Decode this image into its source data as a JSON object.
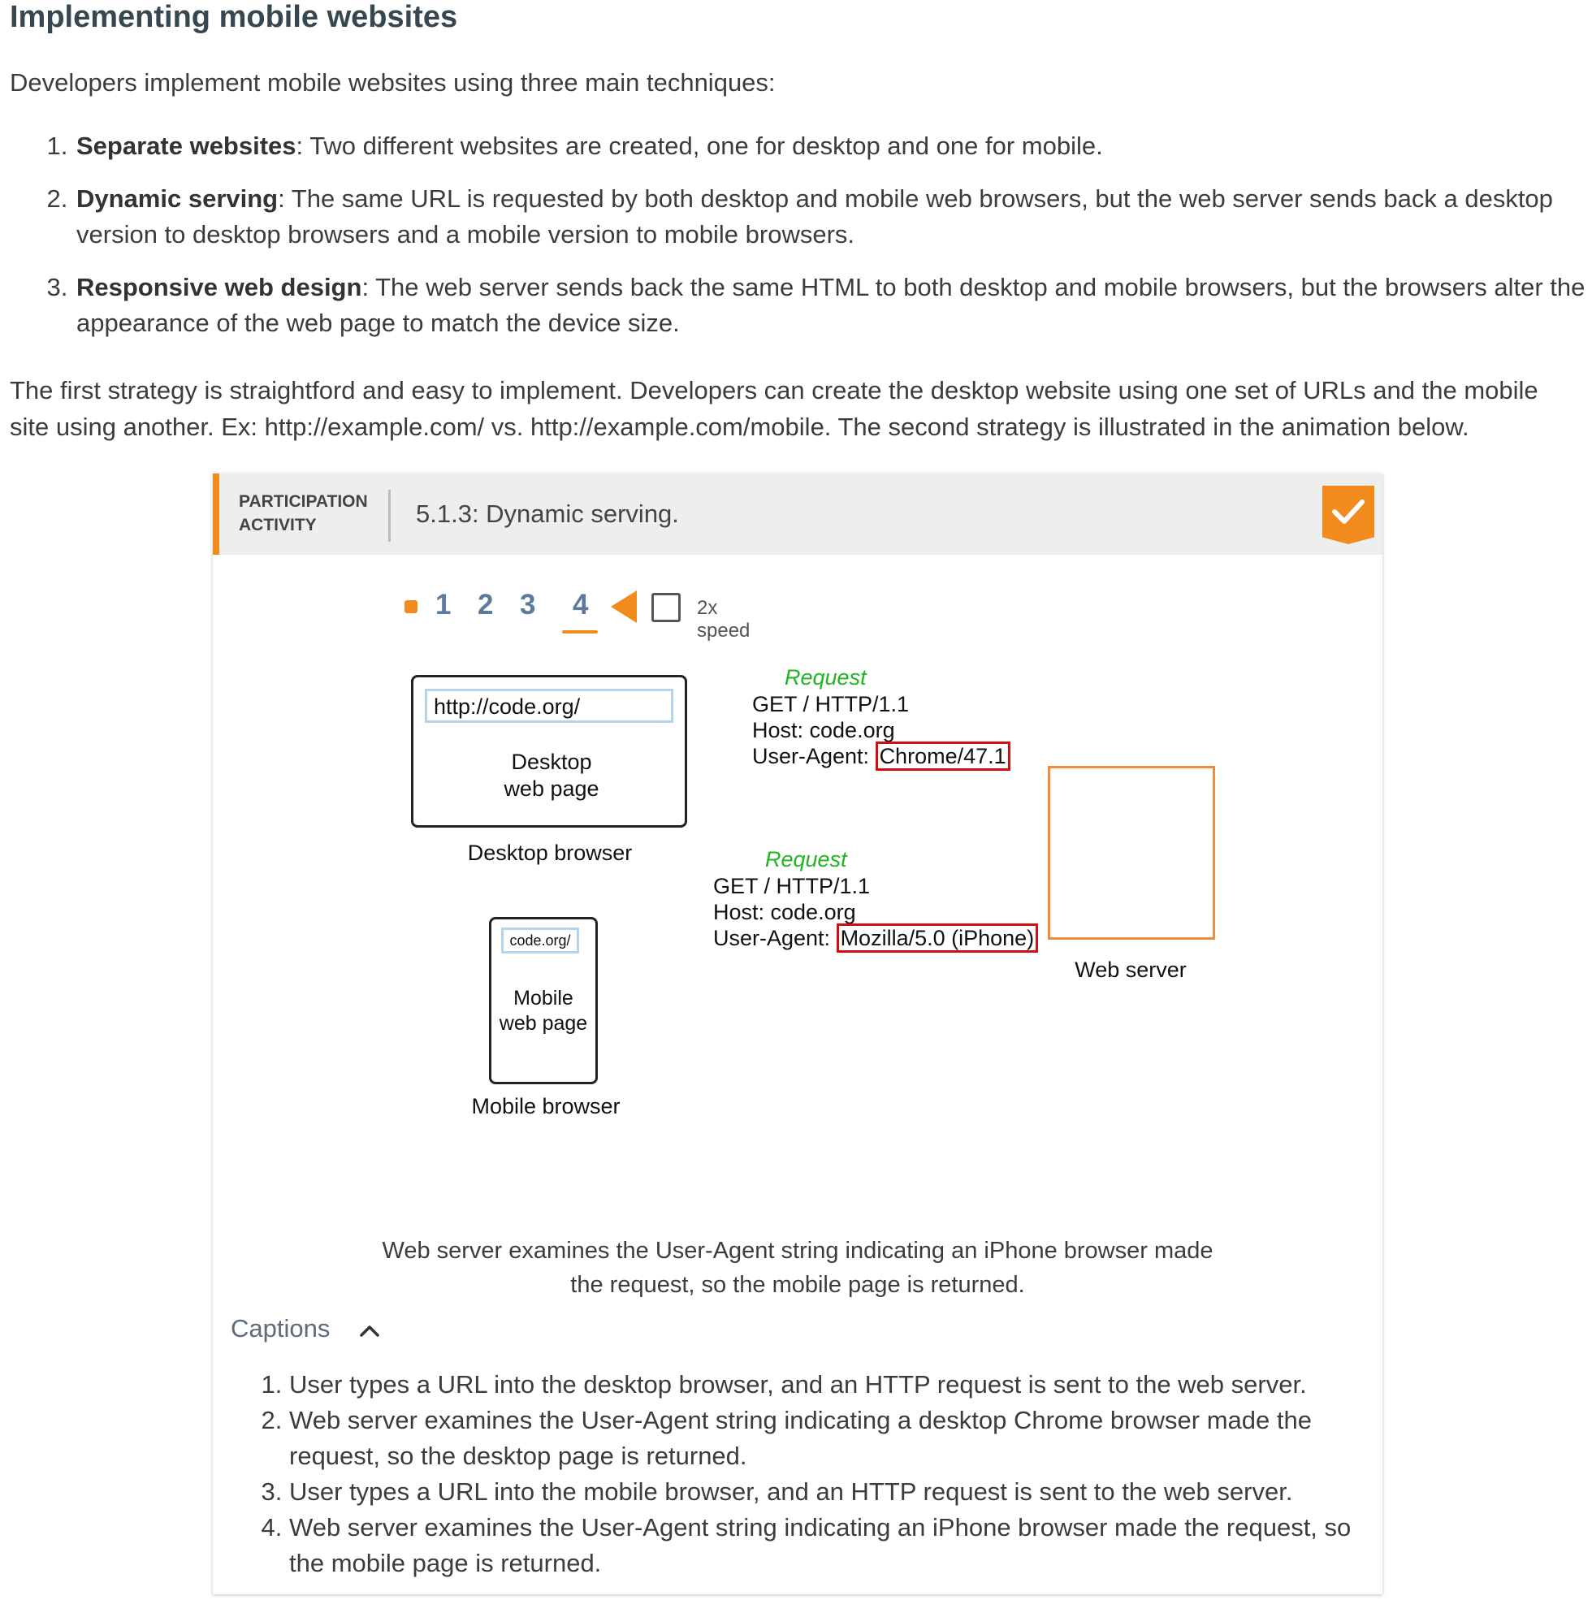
{
  "page": {
    "title": "Implementing mobile websites",
    "intro": "Developers implement mobile websites using three main techniques:",
    "techniques": [
      {
        "term": "Separate websites",
        "text": ": Two different websites are created, one for desktop and one for mobile."
      },
      {
        "term": "Dynamic serving",
        "text": ": The same URL is requested by both desktop and mobile web browsers, but the web server sends back a desktop version to desktop browsers and a mobile version to mobile browsers."
      },
      {
        "term": "Responsive web design",
        "text": ": The web server sends back the same HTML to both desktop and mobile browsers, but the browsers alter the appearance of the web page to match the device size."
      }
    ],
    "paragraph": "The first strategy is straightford and easy to implement. Developers can create the desktop website using one set of URLs and the mobile site using another. Ex: http://example.com/ vs. http://example.com/mobile. The second strategy is illustrated in the animation below."
  },
  "activity": {
    "label_line1": "PARTICIPATION",
    "label_line2": "ACTIVITY",
    "title": "5.1.3: Dynamic serving.",
    "accent_color": "#f38a1d",
    "completed_icon": "check-icon",
    "steps": [
      "1",
      "2",
      "3",
      "4"
    ],
    "current_step": "4",
    "speed_label": "2x speed",
    "diagram": {
      "desktop_url": "http://code.org/",
      "desktop_page_line1": "Desktop",
      "desktop_page_line2": "web page",
      "desktop_caption": "Desktop browser",
      "mobile_url": "code.org/",
      "mobile_page_line1": "Mobile",
      "mobile_page_line2": "web page",
      "mobile_caption": "Mobile browser",
      "desktop_request": {
        "title": "Request",
        "line1": "GET / HTTP/1.1",
        "line2": "Host: code.org",
        "ua_label": "User-Agent: ",
        "ua_value": "Chrome/47.1"
      },
      "mobile_request": {
        "title": "Request",
        "line1": "GET / HTTP/1.1",
        "line2": "Host: code.org",
        "ua_label": "User-Agent: ",
        "ua_value": "Mozilla/5.0 (iPhone)"
      },
      "server_caption": "Web server"
    },
    "current_caption_line1": "Web server examines the User-Agent string indicating an iPhone browser made",
    "current_caption_line2": "the request, so the mobile page is returned.",
    "captions_toggle": "Captions",
    "captions": [
      "User types a URL into the desktop browser, and an HTTP request is sent to the web server.",
      "Web server examines the User-Agent string indicating a desktop Chrome browser made the request, so the desktop page is returned.",
      "User types a URL into the mobile browser, and an HTTP request is sent to the web server.",
      "Web server examines the User-Agent string indicating an iPhone browser made the request, so the mobile page is returned."
    ]
  }
}
